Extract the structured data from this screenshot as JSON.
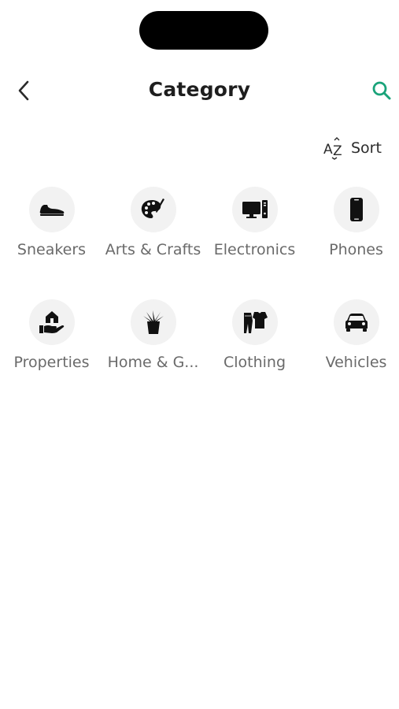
{
  "header": {
    "title": "Category",
    "back_icon": "chevron-left-icon",
    "search_icon": "search-icon",
    "accent_color": "#1aa37a"
  },
  "sort": {
    "icon": "az-sort-icon",
    "label": "Sort"
  },
  "categories": [
    {
      "label": "Sneakers",
      "icon": "sneaker-icon"
    },
    {
      "label": "Arts & Crafts",
      "icon": "palette-icon"
    },
    {
      "label": "Electronics",
      "icon": "desktop-computer-icon"
    },
    {
      "label": "Phones",
      "icon": "smartphone-icon"
    },
    {
      "label": "Properties",
      "icon": "house-in-hand-icon"
    },
    {
      "label": "Home & G...",
      "icon": "potted-plant-icon"
    },
    {
      "label": "Clothing",
      "icon": "clothing-icon"
    },
    {
      "label": "Vehicles",
      "icon": "car-icon"
    }
  ]
}
